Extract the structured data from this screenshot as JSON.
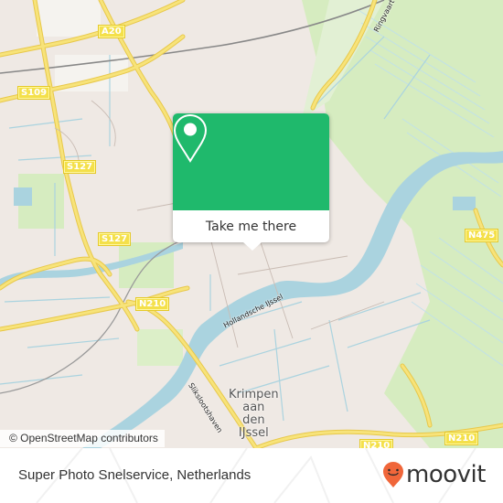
{
  "map": {
    "road_labels": [
      {
        "id": "a20",
        "text": "A20"
      },
      {
        "id": "s109",
        "text": "S109"
      },
      {
        "id": "s127-top",
        "text": "S127"
      },
      {
        "id": "s127-bottom",
        "text": "S127"
      },
      {
        "id": "n210-left",
        "text": "N210"
      },
      {
        "id": "n475",
        "text": "N475"
      },
      {
        "id": "n210-bottom-left",
        "text": "N210"
      },
      {
        "id": "n210-bottom-right",
        "text": "N210"
      }
    ],
    "place_label": {
      "line1": "Krimpen",
      "line2": "aan",
      "line3": "den",
      "line4": "IJssel"
    },
    "water_labels": {
      "hollandsche_ijssel": "Hollandsche IJssel",
      "slikslootshaven": "Slikslootshaven",
      "ringvaart": "Ringvaart"
    },
    "attribution": "© OpenStreetMap contributors",
    "colors": {
      "land": "#efe9e4",
      "water": "#aad3df",
      "green": "#cdebb0",
      "road": "#f7e06e",
      "accent": "#1fb96c"
    }
  },
  "popup": {
    "icon": "location-pin-icon",
    "button_label": "Take me there"
  },
  "footer": {
    "title": "Super Photo Snelservice, Netherlands",
    "logo_text": "moovit",
    "logo_icon": "moovit-smiley-pin-icon",
    "logo_color": "#f0663a"
  }
}
